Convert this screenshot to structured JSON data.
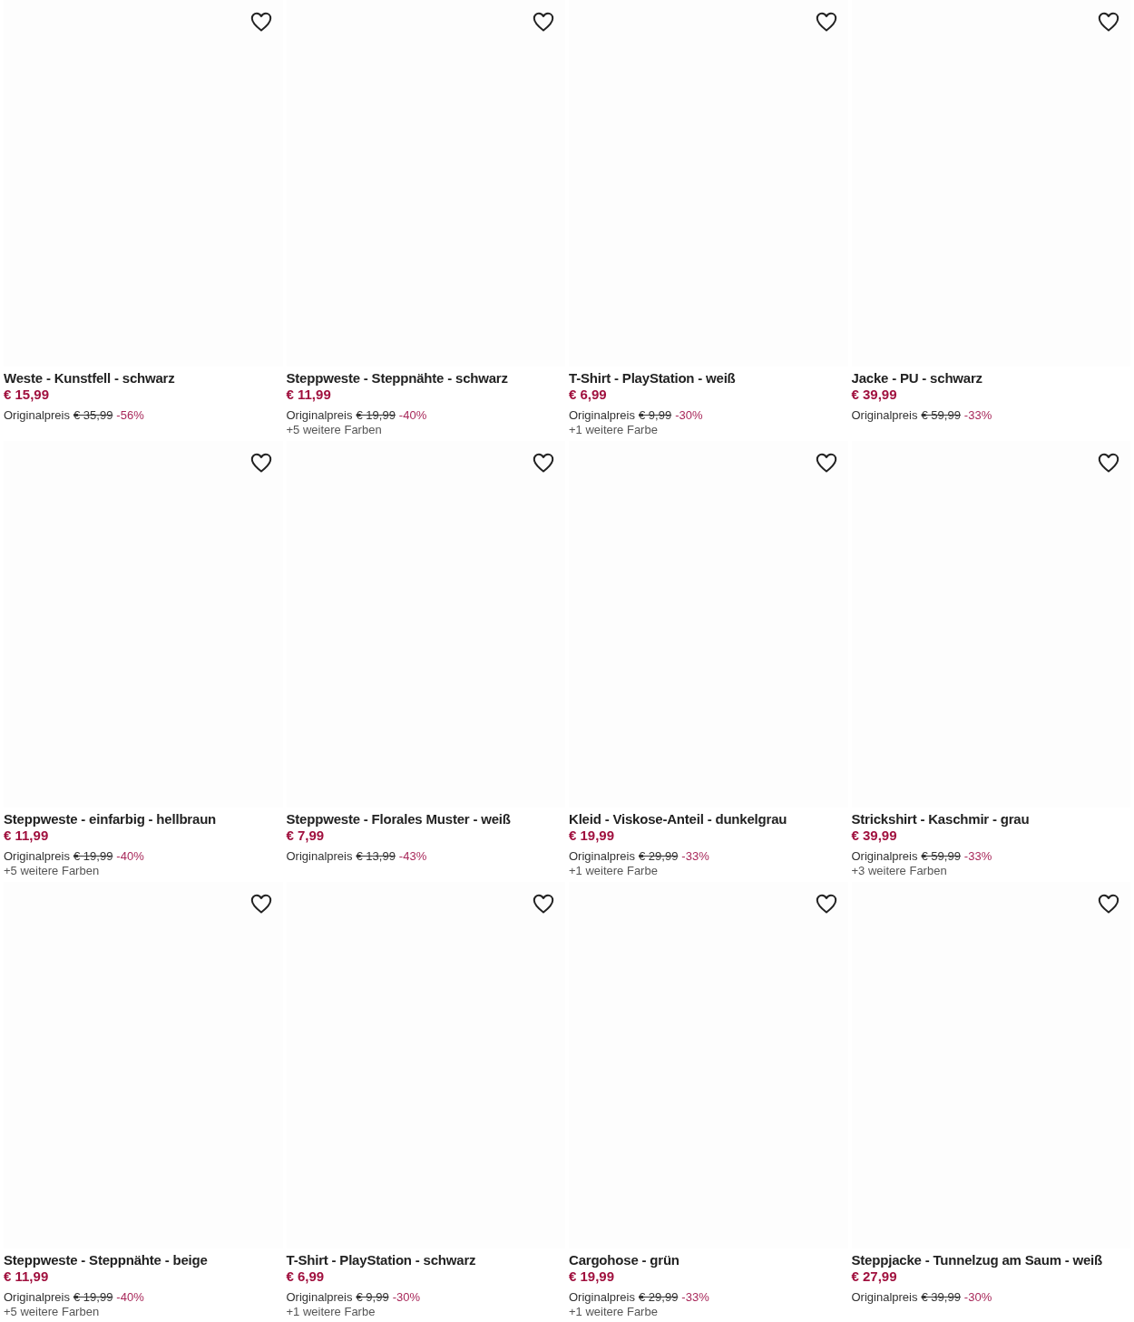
{
  "products": [
    {
      "title": "Weste - Kunstfell - schwarz",
      "price": "€ 15,99",
      "original_label": "Originalpreis",
      "original_price": "€ 35,99",
      "discount": "-56%"
    },
    {
      "title": "Steppweste - Steppnähte - schwarz",
      "price": "€ 11,99",
      "original_label": "Originalpreis",
      "original_price": "€ 19,99",
      "discount": "-40%",
      "colors": "+5 weitere Farben"
    },
    {
      "title": "T-Shirt - PlayStation - weiß",
      "price": "€ 6,99",
      "original_label": "Originalpreis",
      "original_price": "€ 9,99",
      "discount": "-30%",
      "colors": "+1 weitere Farbe"
    },
    {
      "title": "Jacke - PU - schwarz",
      "price": "€ 39,99",
      "original_label": "Originalpreis",
      "original_price": "€ 59,99",
      "discount": "-33%"
    },
    {
      "title": "Steppweste - einfarbig - hellbraun",
      "price": "€ 11,99",
      "original_label": "Originalpreis",
      "original_price": "€ 19,99",
      "discount": "-40%",
      "colors": "+5 weitere Farben"
    },
    {
      "title": "Steppweste - Florales Muster - weiß",
      "price": "€ 7,99",
      "original_label": "Originalpreis",
      "original_price": "€ 13,99",
      "discount": "-43%"
    },
    {
      "title": "Kleid - Viskose-Anteil - dunkelgrau",
      "price": "€ 19,99",
      "original_label": "Originalpreis",
      "original_price": "€ 29,99",
      "discount": "-33%",
      "colors": "+1 weitere Farbe"
    },
    {
      "title": "Strickshirt - Kaschmir - grau",
      "price": "€ 39,99",
      "original_label": "Originalpreis",
      "original_price": "€ 59,99",
      "discount": "-33%",
      "colors": "+3 weitere Farben"
    },
    {
      "title": "Steppweste - Steppnähte - beige",
      "price": "€ 11,99",
      "original_label": "Originalpreis",
      "original_price": "€ 19,99",
      "discount": "-40%",
      "colors": "+5 weitere Farben"
    },
    {
      "title": "T-Shirt - PlayStation - schwarz",
      "price": "€ 6,99",
      "original_label": "Originalpreis",
      "original_price": "€ 9,99",
      "discount": "-30%",
      "colors": "+1 weitere Farbe"
    },
    {
      "title": "Cargohose - grün",
      "price": "€ 19,99",
      "original_label": "Originalpreis",
      "original_price": "€ 29,99",
      "discount": "-33%",
      "colors": "+1 weitere Farbe"
    },
    {
      "title": "Steppjacke - Tunnelzug am Saum - weiß",
      "price": "€ 27,99",
      "original_label": "Originalpreis",
      "original_price": "€ 39,99",
      "discount": "-30%"
    }
  ]
}
